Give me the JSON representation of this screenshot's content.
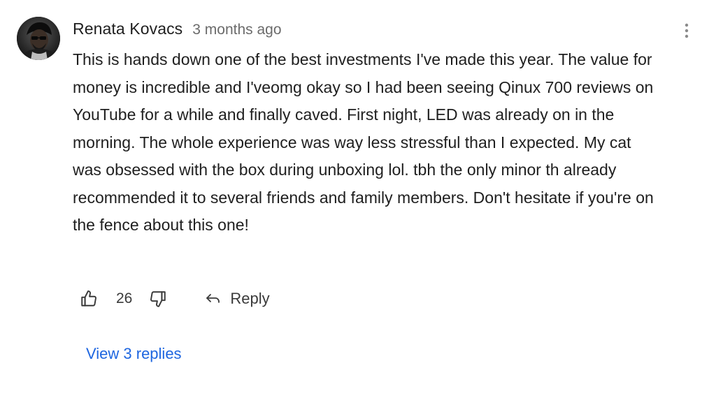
{
  "comment": {
    "author": "Renata Kovacs",
    "timestamp": "3 months ago",
    "text": "This is hands down one of the best investments I've made this year. The value for money is incredible and I'veomg okay so I had been seeing Qinux 700 reviews on YouTube for a while and finally caved. First night, LED was already on in the morning. The whole experience was way less stressful than I expected. My cat was obsessed with the box during unboxing lol. tbh the only minor th already recommended it to several friends and family members. Don't hesitate if you're on the fence about this one!",
    "likes": "26",
    "reply_label": "Reply",
    "view_replies_label": "View 3 replies"
  },
  "icons": {
    "more": "more-vertical-icon",
    "like": "thumbs-up-icon",
    "dislike": "thumbs-down-icon",
    "reply": "reply-arrow-icon"
  },
  "colors": {
    "text": "#1f1f1f",
    "muted": "#6b6b6b",
    "link": "#1e66e0"
  }
}
